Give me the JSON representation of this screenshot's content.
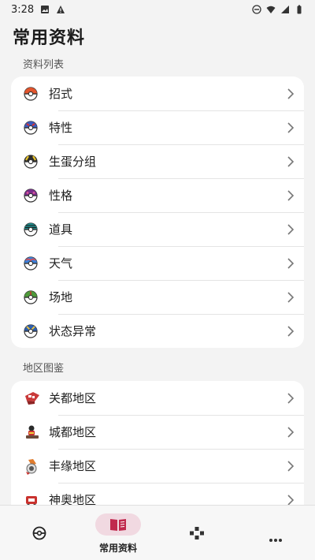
{
  "status": {
    "time": "3:28"
  },
  "page": {
    "title": "常用资料"
  },
  "sections": [
    {
      "title": "资料列表",
      "items": [
        {
          "label": "招式",
          "icon": "poke-ball-icon"
        },
        {
          "label": "特性",
          "icon": "great-ball-icon"
        },
        {
          "label": "生蛋分组",
          "icon": "ultra-ball-icon"
        },
        {
          "label": "性格",
          "icon": "master-ball-icon"
        },
        {
          "label": "道具",
          "icon": "net-ball-icon"
        },
        {
          "label": "天气",
          "icon": "dive-ball-icon"
        },
        {
          "label": "场地",
          "icon": "friend-ball-icon"
        },
        {
          "label": "状态异常",
          "icon": "quick-ball-icon"
        }
      ]
    },
    {
      "title": "地区图鉴",
      "items": [
        {
          "label": "关都地区",
          "icon": "kanto-icon"
        },
        {
          "label": "城都地区",
          "icon": "johto-icon"
        },
        {
          "label": "丰缘地区",
          "icon": "hoenn-icon"
        },
        {
          "label": "神奥地区",
          "icon": "sinnoh-icon"
        }
      ]
    }
  ],
  "nav": {
    "items": [
      {
        "label": "",
        "icon": "pokeball-icon"
      },
      {
        "label": "常用资料",
        "icon": "book-icon",
        "active": true
      },
      {
        "label": "",
        "icon": "gamepad-icon"
      },
      {
        "label": "",
        "icon": "more-icon"
      }
    ]
  },
  "colors": {
    "accent_pill": "#f1d9e1",
    "accent_icon": "#c0284d"
  }
}
